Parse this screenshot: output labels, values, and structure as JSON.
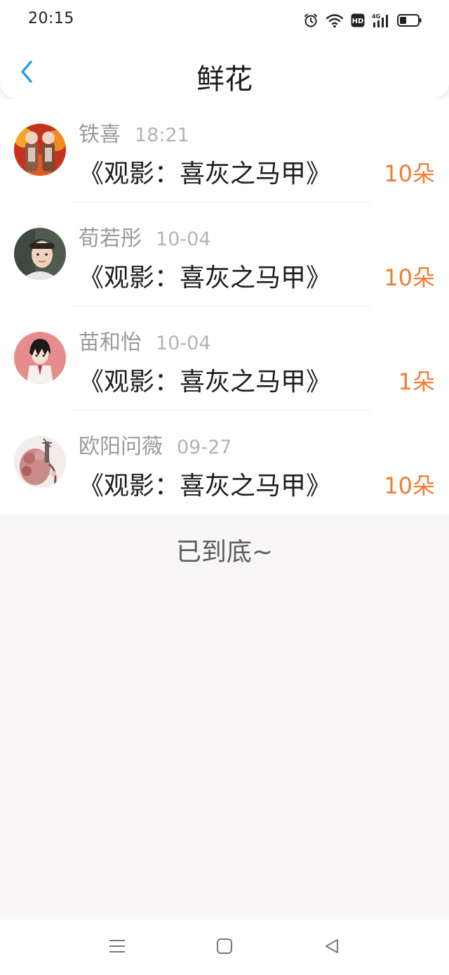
{
  "status_bar": {
    "time": "20:15",
    "icons": [
      "alarm-icon",
      "wifi-icon",
      "hd-icon",
      "signal-4g-icon",
      "battery-icon"
    ]
  },
  "header": {
    "title": "鲜花",
    "back_icon": "chevron-left-icon"
  },
  "colors": {
    "accent_back": "#2f9be6",
    "flower_count": "#ee7d35",
    "name_gray": "#9a9a9a",
    "time_gray": "#b3b3b3"
  },
  "gifts": [
    {
      "name": "铁喜",
      "time": "18:21",
      "book": "《观影：喜灰之马甲》",
      "count": "10朵"
    },
    {
      "name": "荀若彤",
      "time": "10-04",
      "book": "《观影：喜灰之马甲》",
      "count": "10朵"
    },
    {
      "name": "苗和怡",
      "time": "10-04",
      "book": "《观影：喜灰之马甲》",
      "count": "1朵"
    },
    {
      "name": "欧阳问薇",
      "time": "09-27",
      "book": "《观影：喜灰之马甲》",
      "count": "10朵"
    }
  ],
  "footer": {
    "end_text": "已到底~"
  },
  "nav_bar": {
    "icons": [
      "menu-icon",
      "home-square-icon",
      "back-triangle-icon"
    ]
  }
}
